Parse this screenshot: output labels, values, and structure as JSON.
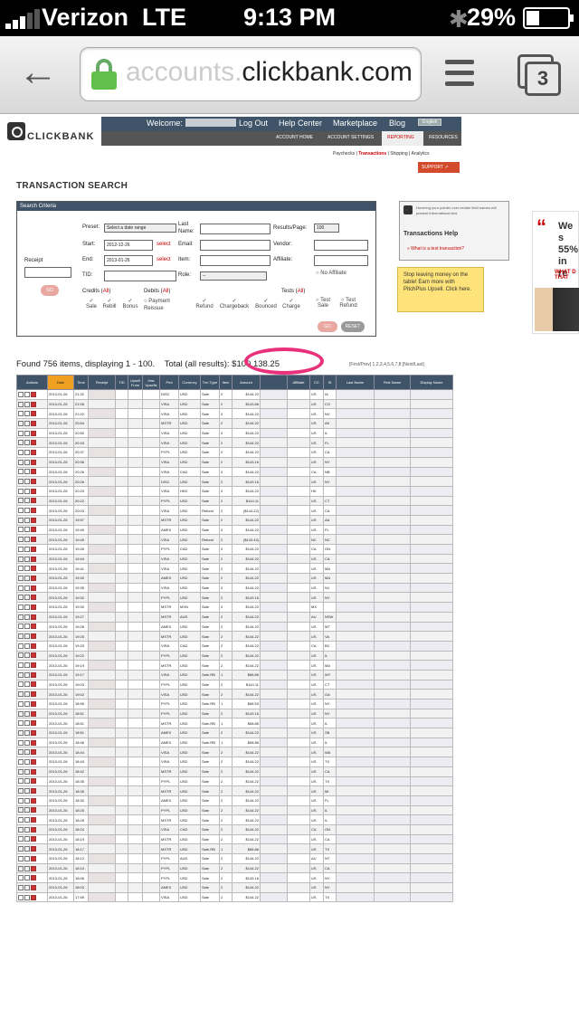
{
  "status": {
    "carrier": "Verizon",
    "network": "LTE",
    "time": "9:13 PM",
    "battery": "29%"
  },
  "browser": {
    "url_prefix": "accounts.",
    "url_domain": "clickbank.com",
    "tab_count": "3"
  },
  "header": {
    "logo": "CLICKBANK",
    "welcome": "Welcome:",
    "links": [
      "Log Out",
      "Help Center",
      "Marketplace",
      "Blog"
    ],
    "lang": "English",
    "nav": [
      "ACCOUNT HOME",
      "ACCOUNT SETTINGS",
      "REPORTING",
      "RESOURCES"
    ],
    "subnav": [
      "Paychecks",
      "Transactions",
      "Shipping",
      "Analytics"
    ],
    "support": "SUPPORT"
  },
  "page_title": "TRANSACTION SEARCH",
  "search": {
    "header": "Search Criteria",
    "receipt_label": "Receipt",
    "preset_label": "Preset:",
    "preset_value": "Select a date range",
    "start_label": "Start:",
    "start_value": "2012-12-26",
    "end_label": "End:",
    "end_value": "2013-01-26",
    "select_label": "select",
    "tid_label": "TID:",
    "last_name_label": "Last Name:",
    "email_label": "Email:",
    "item_label": "Item:",
    "role_label": "Role:",
    "role_value": "--",
    "results_label": "Results/Page:",
    "results_value": "100",
    "vendor_label": "Vendor:",
    "affiliate_label": "Affiliate:",
    "no_affiliate": "No Affiliate",
    "credits_label": "Credits",
    "debits_label": "Debits",
    "tests_label": "Tests",
    "all_label": "All",
    "types": [
      "Sale",
      "Rebill",
      "Bonus",
      "Payment Reissue",
      "Refund",
      "Chargeback",
      "Bounced",
      "Charge",
      "Test Sale",
      "Test Refund"
    ],
    "go": "GO",
    "reset": "RESET"
  },
  "help": {
    "note": "Hovering your pointer over certain field names will present informational text.",
    "title": "Transactions Help",
    "link": "» What is a test transaction?"
  },
  "promo": "Stop leaving money on the table! Earn more with PitchPlus Upsell. Click here.",
  "ad": {
    "line1": "We s",
    "line2": "55%",
    "line3": "in re",
    "line4": "WHAT D",
    "line5": "THAT"
  },
  "results": {
    "found": "Found 756 items, displaying 1 - 100.",
    "total_label": "Total (all results):",
    "total": "$100,138.25",
    "pager": "[First/Prev] 1,2,3,4,5,6,7,8 [Next/Last]"
  },
  "table": {
    "headers": [
      "Actions",
      "Date",
      "Time",
      "Receipt",
      "TID",
      "Upsell From",
      "Has Upsells",
      "Pmt",
      "Currency",
      "Txn Type",
      "Item",
      "Amount",
      "",
      "Affiliate",
      "CC",
      "St",
      "Last Name",
      "First Name",
      "Display Name"
    ],
    "rows": [
      [
        "2013-01-26",
        "21:32",
        "DISC",
        "USD",
        "Sale",
        "2",
        "$144.22",
        "US",
        "IA"
      ],
      [
        "2013-01-26",
        "21:06",
        "VISA",
        "USD",
        "Sale",
        "2",
        "$143.86",
        "US",
        "CO"
      ],
      [
        "2013-01-26",
        "21:02",
        "VISA",
        "USD",
        "Sale",
        "2",
        "$144.22",
        "US",
        "NV"
      ],
      [
        "2013-01-26",
        "20:54",
        "MSTR",
        "USD",
        "Sale",
        "2",
        "$144.22",
        "US",
        "AK"
      ],
      [
        "2013-01-26",
        "20:50",
        "VISA",
        "USD",
        "Sale",
        "2",
        "$144.22",
        "US",
        "IL"
      ],
      [
        "2013-01-26",
        "20:43",
        "VISA",
        "USD",
        "Sale",
        "2",
        "$144.22",
        "US",
        "FL"
      ],
      [
        "2013-01-26",
        "20:37",
        "PYPL",
        "USD",
        "Sale",
        "2",
        "$144.22",
        "US",
        "CA"
      ],
      [
        "2013-01-26",
        "20:36",
        "VISA",
        "USD",
        "Sale",
        "2",
        "$143.16",
        "US",
        "NY"
      ],
      [
        "2013-01-26",
        "20:26",
        "VISA",
        "CAD",
        "Sale",
        "2",
        "$144.22",
        "CA",
        "NB"
      ],
      [
        "2013-01-26",
        "20:26",
        "DISC",
        "USD",
        "Sale",
        "2",
        "$143.16",
        "US",
        "NY"
      ],
      [
        "2013-01-26",
        "20:23",
        "VISA",
        "HKD",
        "Sale",
        "2",
        "$144.22",
        "HK",
        ""
      ],
      [
        "2013-01-26",
        "20:22",
        "PYPL",
        "USD",
        "Sale",
        "2",
        "$144.11",
        "US",
        "CT"
      ],
      [
        "2013-01-26",
        "20:03",
        "VISA",
        "USD",
        "Refund",
        "2",
        "($144.22)",
        "US",
        "CA"
      ],
      [
        "2013-01-26",
        "19:57",
        "MSTR",
        "USD",
        "Sale",
        "2",
        "$144.22",
        "US",
        "AA"
      ],
      [
        "2013-01-26",
        "19:49",
        "AMEX",
        "USD",
        "Sale",
        "2",
        "$144.22",
        "US",
        "FL"
      ],
      [
        "2013-01-26",
        "19:45",
        "VISA",
        "USD",
        "Refund",
        "2",
        "($143.43)",
        "NC",
        "NC"
      ],
      [
        "2013-01-26",
        "19:45",
        "PYPL",
        "CAD",
        "Sale",
        "2",
        "$144.22",
        "CA",
        "ON"
      ],
      [
        "2013-01-26",
        "19:44",
        "VISA",
        "USD",
        "Sale",
        "2",
        "$144.22",
        "US",
        "CA"
      ],
      [
        "2013-01-26",
        "19:41",
        "VISA",
        "USD",
        "Sale",
        "2",
        "$144.22",
        "US",
        "MA"
      ],
      [
        "2013-01-26",
        "19:40",
        "AMEX",
        "USD",
        "Sale",
        "2",
        "$144.22",
        "US",
        "MA"
      ],
      [
        "2013-01-26",
        "19:35",
        "VISA",
        "USD",
        "Sale",
        "2",
        "$144.22",
        "US",
        "NJ"
      ],
      [
        "2013-01-26",
        "19:32",
        "PYPL",
        "USD",
        "Sale",
        "2",
        "$143.16",
        "US",
        "NY"
      ],
      [
        "2013-01-26",
        "19:30",
        "MSTR",
        "MXN",
        "Sale",
        "2",
        "$144.22",
        "MX",
        ""
      ],
      [
        "2013-01-26",
        "19:27",
        "MSTR",
        "AUD",
        "Sale",
        "2",
        "$144.22",
        "AU",
        "NSW"
      ],
      [
        "2013-01-26",
        "19:26",
        "AMEX",
        "USD",
        "Sale",
        "2",
        "$144.22",
        "US",
        "MT"
      ],
      [
        "2013-01-26",
        "19:25",
        "MSTR",
        "USD",
        "Sale",
        "2",
        "$144.22",
        "US",
        "VA"
      ],
      [
        "2013-01-26",
        "19:23",
        "VISA",
        "CAD",
        "Sale",
        "2",
        "$144.22",
        "CA",
        "BC"
      ],
      [
        "2013-01-26",
        "19:22",
        "PYPL",
        "USD",
        "Sale",
        "2",
        "$144.22",
        "US",
        "IL"
      ],
      [
        "2013-01-26",
        "19:19",
        "MSTR",
        "USD",
        "Sale",
        "2",
        "$144.22",
        "US",
        "MA"
      ],
      [
        "2013-01-26",
        "19:17",
        "VISA",
        "USD",
        "Sale-RB",
        "1",
        "$68.86",
        "US",
        "WY"
      ],
      [
        "2013-01-26",
        "19:03",
        "PYPL",
        "USD",
        "Sale",
        "2",
        "$144.11",
        "US",
        "CT"
      ],
      [
        "2013-01-26",
        "19:02",
        "VISA",
        "USD",
        "Sale",
        "2",
        "$144.22",
        "US",
        "GA"
      ],
      [
        "2013-01-26",
        "18:56",
        "PYPL",
        "USD",
        "Sale-RB",
        "1",
        "$68.53",
        "US",
        "NY"
      ],
      [
        "2013-01-26",
        "18:51",
        "PYPL",
        "USD",
        "Sale",
        "2",
        "$143.16",
        "US",
        "NY"
      ],
      [
        "2013-01-26",
        "18:51",
        "MSTR",
        "USD",
        "Sale-RB",
        "1",
        "$68.86",
        "US",
        "IL"
      ],
      [
        "2013-01-26",
        "18:51",
        "AMEX",
        "USD",
        "Sale",
        "2",
        "$144.22",
        "US",
        "SB"
      ],
      [
        "2013-01-26",
        "18:46",
        "AMEX",
        "USD",
        "Sale-RB",
        "1",
        "$68.86",
        "US",
        "IL"
      ],
      [
        "2013-01-26",
        "18:44",
        "VISA",
        "USD",
        "Sale",
        "2",
        "$144.22",
        "US",
        "WA"
      ],
      [
        "2013-01-26",
        "18:43",
        "VISA",
        "USD",
        "Sale",
        "2",
        "$144.22",
        "US",
        "TX"
      ],
      [
        "2013-01-26",
        "18:42",
        "MSTR",
        "USD",
        "Sale",
        "2",
        "$144.22",
        "US",
        "CA"
      ],
      [
        "2013-01-26",
        "18:35",
        "PYPL",
        "USD",
        "Sale",
        "2",
        "$144.22",
        "US",
        "TX"
      ],
      [
        "2013-01-26",
        "18:35",
        "MSTR",
        "USD",
        "Sale",
        "2",
        "$144.22",
        "US",
        "MI"
      ],
      [
        "2013-01-26",
        "18:30",
        "AMEX",
        "USD",
        "Sale",
        "2",
        "$144.22",
        "US",
        "FL"
      ],
      [
        "2013-01-26",
        "18:25",
        "PYPL",
        "USD",
        "Sale",
        "2",
        "$144.22",
        "US",
        "IL"
      ],
      [
        "2013-01-26",
        "18:25",
        "MSTR",
        "USD",
        "Sale",
        "2",
        "$144.22",
        "US",
        "IL"
      ],
      [
        "2013-01-26",
        "18:24",
        "VISA",
        "CAD",
        "Sale",
        "2",
        "$144.22",
        "CA",
        "ON"
      ],
      [
        "2013-01-26",
        "18:19",
        "MSTR",
        "USD",
        "Sale",
        "2",
        "$144.22",
        "US",
        "CA"
      ],
      [
        "2013-01-26",
        "18:17",
        "MSTR",
        "USD",
        "Sale-RB",
        "1",
        "$68.86",
        "US",
        "TX"
      ],
      [
        "2013-01-26",
        "18:12",
        "PYPL",
        "AUD",
        "Sale",
        "2",
        "$144.22",
        "AU",
        "NT"
      ],
      [
        "2013-01-26",
        "18:10",
        "PYPL",
        "USD",
        "Sale",
        "2",
        "$144.22",
        "US",
        "CA"
      ],
      [
        "2013-01-26",
        "18:06",
        "PYPL",
        "USD",
        "Sale",
        "2",
        "$143.16",
        "US",
        "NY"
      ],
      [
        "2013-01-26",
        "18:03",
        "AMEX",
        "USD",
        "Sale",
        "2",
        "$144.22",
        "US",
        "NY"
      ],
      [
        "2013-01-26",
        "17:59",
        "VISA",
        "USD",
        "Sale",
        "2",
        "$144.22",
        "US",
        "TX"
      ]
    ]
  }
}
